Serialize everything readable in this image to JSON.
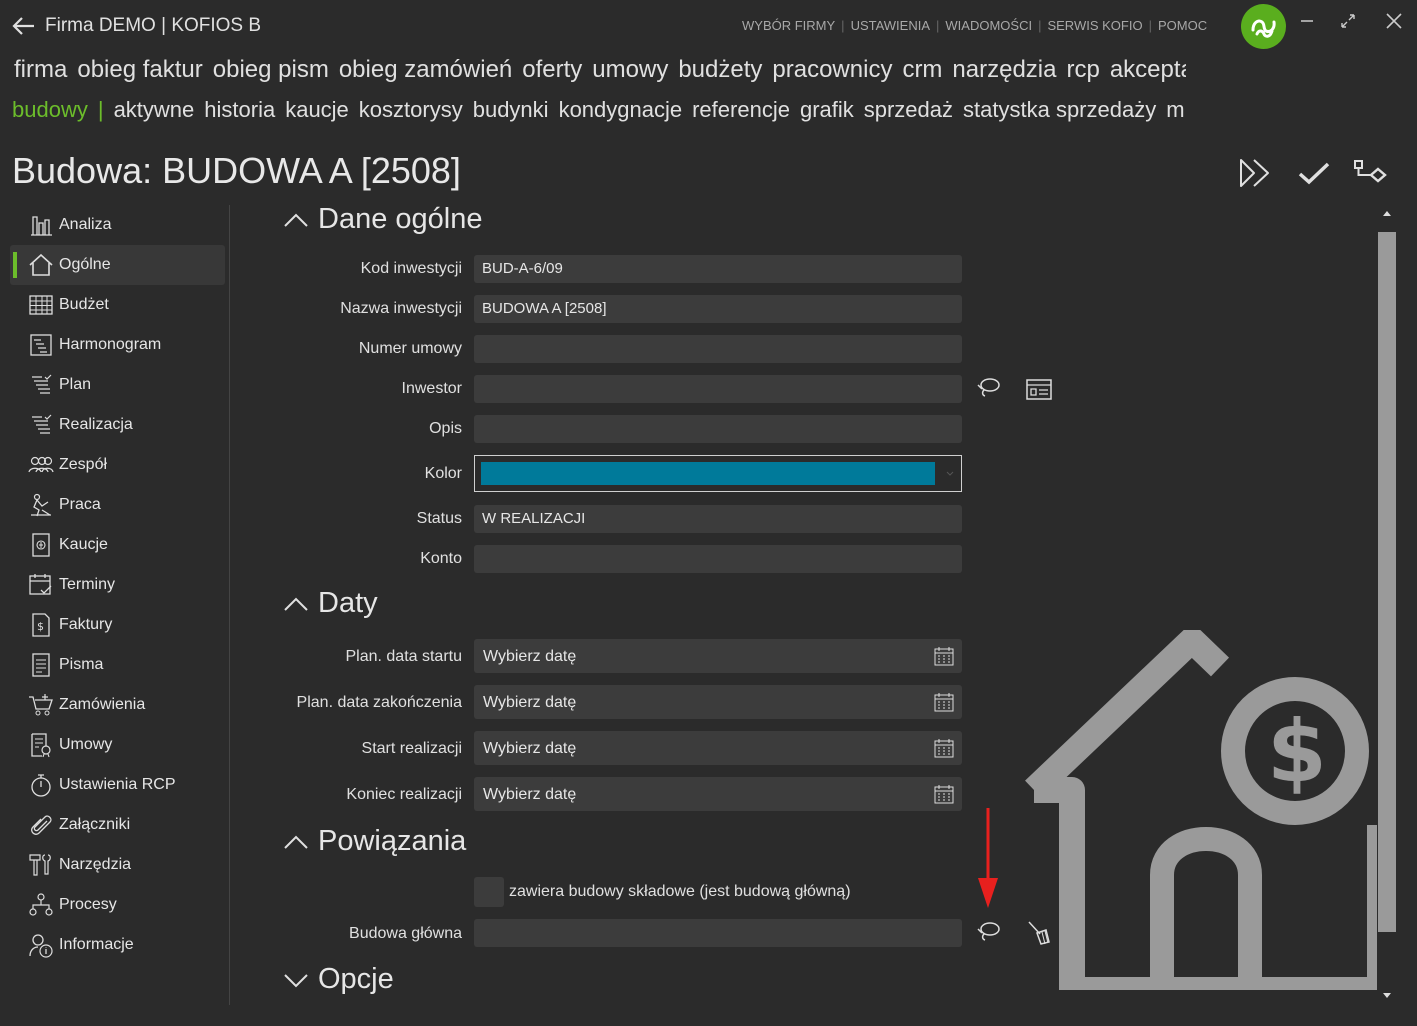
{
  "window": {
    "title": "Firma DEMO | KOFIOS B",
    "topnav": [
      "WYBÓR FIRMY",
      "USTAWIENIA",
      "WIADOMOŚCI",
      "SERWIS KOFIO",
      "POMOC"
    ]
  },
  "modules": [
    "firma",
    "obieg faktur",
    "obieg pism",
    "obieg zamówień",
    "oferty",
    "umowy",
    "budżety",
    "pracownicy",
    "crm",
    "narzędzia",
    "rcp",
    "akcepta"
  ],
  "submenu": {
    "active": "budowy",
    "separator": "|",
    "items": [
      "aktywne",
      "historia",
      "kaucje",
      "kosztorysy",
      "budynki",
      "kondygnacje",
      "referencje",
      "grafik",
      "sprzedaż",
      "statystka sprzedaży",
      "moje z"
    ]
  },
  "page": {
    "title": "Budowa: BUDOWA A  [2508]"
  },
  "sidebar": {
    "items": [
      {
        "label": "Analiza",
        "icon": "bar-chart-icon"
      },
      {
        "label": "Ogólne",
        "icon": "home-icon"
      },
      {
        "label": "Budżet",
        "icon": "table-icon"
      },
      {
        "label": "Harmonogram",
        "icon": "schedule-icon"
      },
      {
        "label": "Plan",
        "icon": "plan-list-icon"
      },
      {
        "label": "Realizacja",
        "icon": "realization-list-icon"
      },
      {
        "label": "Zespół",
        "icon": "team-icon"
      },
      {
        "label": "Praca",
        "icon": "worker-icon"
      },
      {
        "label": "Kaucje",
        "icon": "deposit-icon"
      },
      {
        "label": "Terminy",
        "icon": "calendar-check-icon"
      },
      {
        "label": "Faktury",
        "icon": "invoice-icon"
      },
      {
        "label": "Pisma",
        "icon": "document-icon"
      },
      {
        "label": "Zamówienia",
        "icon": "cart-icon"
      },
      {
        "label": "Umowy",
        "icon": "contract-icon"
      },
      {
        "label": "Ustawienia RCP",
        "icon": "stopwatch-icon"
      },
      {
        "label": "Załączniki",
        "icon": "paperclip-icon"
      },
      {
        "label": "Narzędzia",
        "icon": "tools-icon"
      },
      {
        "label": "Procesy",
        "icon": "process-icon"
      },
      {
        "label": "Informacje",
        "icon": "info-user-icon"
      }
    ],
    "active_index": 1
  },
  "sections": {
    "general": {
      "title": "Dane ogólne",
      "fields": {
        "kod": {
          "label": "Kod inwestycji",
          "value": "BUD-A-6/09"
        },
        "nazwa": {
          "label": "Nazwa inwestycji",
          "value": "BUDOWA A  [2508]"
        },
        "umowa": {
          "label": "Numer umowy",
          "value": ""
        },
        "inwestor": {
          "label": "Inwestor",
          "value": ""
        },
        "opis": {
          "label": "Opis",
          "value": ""
        },
        "kolor": {
          "label": "Kolor",
          "value": "#007a9a"
        },
        "status": {
          "label": "Status",
          "value": "W REALIZACJI"
        },
        "konto": {
          "label": "Konto",
          "value": ""
        }
      }
    },
    "dates": {
      "title": "Daty",
      "placeholder": "Wybierz datę",
      "fields": [
        {
          "label": "Plan. data startu"
        },
        {
          "label": "Plan. data zakończenia"
        },
        {
          "label": "Start realizacji"
        },
        {
          "label": "Koniec realizacji"
        }
      ]
    },
    "relations": {
      "title": "Powiązania",
      "checkbox_label": "zawiera budowy składowe (jest budową główną)",
      "checkbox_checked": false,
      "main_label": "Budowa główna",
      "main_value": ""
    },
    "options": {
      "title": "Opcje"
    }
  },
  "colors": {
    "accent": "#6cbd2b",
    "background": "#2b2b2b",
    "field": "#3c3c3c",
    "annotation": "#e8201e"
  }
}
